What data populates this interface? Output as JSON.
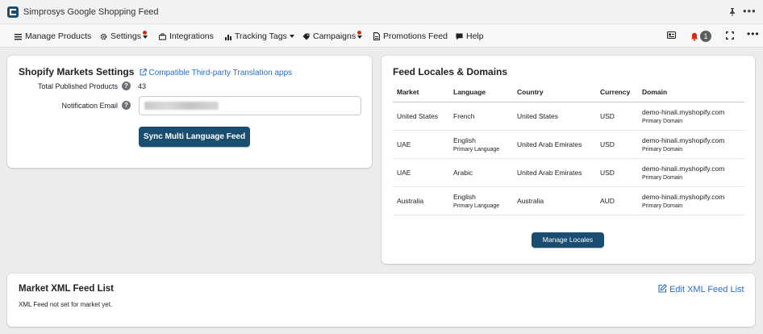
{
  "app": {
    "title": "Simprosys Google Shopping Feed",
    "more_label": "•••"
  },
  "nav": {
    "items": [
      {
        "label": "Manage Products",
        "icon": "list-icon"
      },
      {
        "label": "Settings",
        "icon": "gear-icon"
      },
      {
        "label": "Integrations",
        "icon": "briefcase-icon"
      },
      {
        "label": "Tracking Tags",
        "icon": "bar-chart-icon"
      },
      {
        "label": "Campaigns",
        "icon": "tag-icon"
      },
      {
        "label": "Promotions Feed",
        "icon": "document-icon"
      },
      {
        "label": "Help",
        "icon": "chat-icon"
      }
    ],
    "notification_count": "1",
    "more_label": "•••"
  },
  "markets": {
    "title": "Shopify Markets Settings",
    "link_label": "Compatible Third-party Translation apps",
    "total_label": "Total Published Products",
    "total_value": "43",
    "email_label": "Notification Email",
    "sync_button": "Sync Multi Language Feed"
  },
  "locales": {
    "title": "Feed Locales & Domains",
    "columns": [
      "Market",
      "Language",
      "Country",
      "Currency",
      "Domain"
    ],
    "rows": [
      {
        "market": "United States",
        "language": "French",
        "language_sub": "",
        "country": "United States",
        "currency": "USD",
        "domain": "demo-hinali.myshopify.com",
        "domain_sub": "Primary Domain"
      },
      {
        "market": "UAE",
        "language": "English",
        "language_sub": "Primary Language",
        "country": "United Arab Emirates",
        "currency": "USD",
        "domain": "demo-hinali.myshopify.com",
        "domain_sub": "Primary Domain"
      },
      {
        "market": "UAE",
        "language": "Arabic",
        "language_sub": "",
        "country": "United Arab Emirates",
        "currency": "USD",
        "domain": "demo-hinali.myshopify.com",
        "domain_sub": "Primary Domain"
      },
      {
        "market": "Australia",
        "language": "English",
        "language_sub": "Primary Language",
        "country": "Australia",
        "currency": "AUD",
        "domain": "demo-hinali.myshopify.com",
        "domain_sub": "Primary Domain"
      }
    ],
    "manage_button": "Manage Locales"
  },
  "xml": {
    "title": "Market XML Feed List",
    "empty_message": "XML Feed not set for market yet.",
    "edit_link": "Edit XML Feed List"
  },
  "colors": {
    "primary_button": "#1b4d70",
    "link": "#2c6ecb",
    "alert": "#d72c0d"
  }
}
